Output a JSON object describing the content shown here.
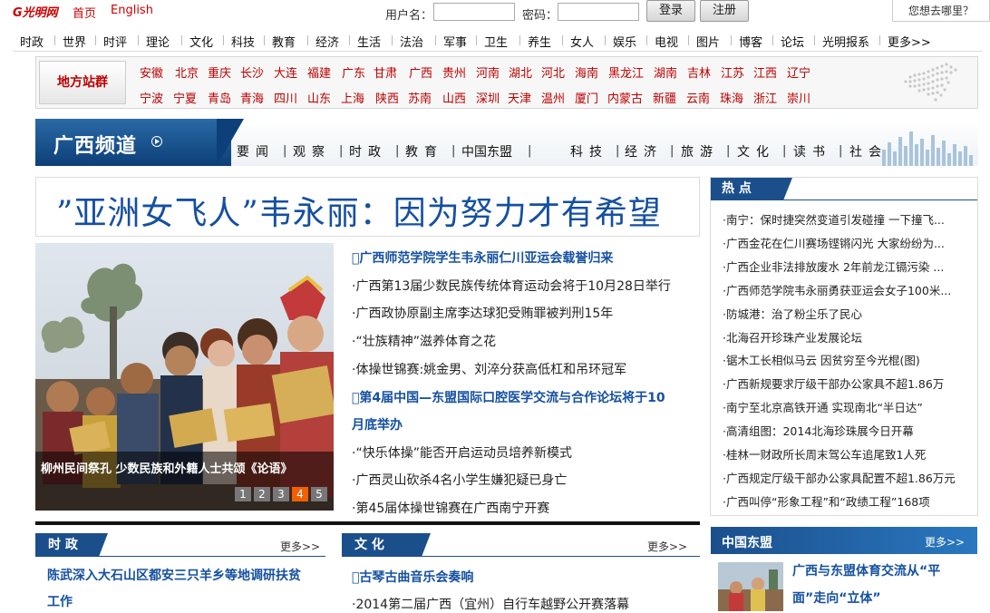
{
  "topbar": {
    "logo": "G光明网",
    "home": "首页",
    "english": "English",
    "username_label": "用户名：",
    "password_label": "密码：",
    "login": "登录",
    "register": "注册",
    "whereto": "您想去哪里？"
  },
  "mainnav": [
    "时政",
    "世界",
    "时评",
    "理论",
    "文化",
    "科技",
    "教育",
    "经济",
    "生活",
    "法治",
    "军事",
    "卫生",
    "养生",
    "女人",
    "娱乐",
    "电视",
    "图片",
    "博客",
    "论坛",
    "光明报系",
    "更多>>"
  ],
  "stations": {
    "label": "地方站群",
    "row1": [
      "安徽",
      "北京",
      "重庆",
      "长沙",
      "大连",
      "福建",
      "广东",
      "甘肃",
      "广西",
      "贵州",
      "河南",
      "湖北",
      "河北",
      "海南",
      "黑龙江",
      "湖南",
      "吉林",
      "江苏",
      "江西",
      "辽宁"
    ],
    "row2": [
      "宁波",
      "宁夏",
      "青岛",
      "青海",
      "四川",
      "山东",
      "上海",
      "陕西",
      "苏南",
      "山西",
      "深圳",
      "天津",
      "温州",
      "厦门",
      "内蒙古",
      "新疆",
      "云南",
      "珠海",
      "浙江",
      "崇川"
    ]
  },
  "channel": {
    "title": "广西频道",
    "nav": [
      "要闻",
      "观察",
      "时政",
      "教育",
      "中国东盟",
      "科技",
      "经济",
      "旅游",
      "文化",
      "读书",
      "社会"
    ]
  },
  "headline": "”亚洲女飞人”韦永丽：因为努力才有希望",
  "slideshow": {
    "caption": "柳州民间祭孔 少数民族和外籍人士共颂《论语》",
    "pages": [
      "1",
      "2",
      "3",
      "4",
      "5"
    ],
    "active_page": 4
  },
  "news": [
    {
      "text": "广西师范学院学生韦永丽仁川亚运会载誉归来",
      "bold": true
    },
    {
      "text": "·广西第13届少数民族传统体育运动会将于10月28日举行",
      "bold": false
    },
    {
      "text": "·广西政协原副主席李达球犯受贿罪被判刑15年",
      "bold": false
    },
    {
      "text": "·“壮族精神”滋养体育之花",
      "bold": false
    },
    {
      "text": "·体操世锦赛:姚金男、刘淬分获高低杠和吊环冠军",
      "bold": false
    },
    {
      "text": "第4届中国—东盟国际口腔医学交流与合作论坛将于10",
      "bold": true
    },
    {
      "text": "月底举办",
      "bold": true
    },
    {
      "text": "·“快乐体操”能否开启运动员培养新模式",
      "bold": false
    },
    {
      "text": "·广西灵山砍杀4名小学生嫌犯疑已身亡",
      "bold": false
    },
    {
      "text": "·第45届体操世锦赛在广西南宁开赛",
      "bold": false
    }
  ],
  "hot": {
    "title": "热 点",
    "items": [
      "·南宁：保时捷突然变道引发碰撞 一下撞飞...",
      "·广西金花在仁川赛场铿锵闪光 大家纷纷为...",
      "·广西企业非法排放废水 2年前龙江镉污染 ...",
      "·广西师范学院韦永丽勇获亚运会女子100米...",
      "·防城港：治了粉尘乐了民心",
      "·北海召开珍珠产业发展论坛",
      "·锯木工长相似马云 因贫穷至今光棍(图)",
      "·广西新规要求厅级干部办公家具不超1.86万",
      "·南宁至北京高铁开通 实现南北“半日达”",
      "·高清组图：2014北海珍珠展今日开幕",
      "·桂林一财政所长周末驾公车追尾致1人死",
      "·广西规定厅级干部办公家具配置不超1.86万元",
      "·广西叫停“形象工程”和“政绩工程”168项"
    ]
  },
  "sections": {
    "politics": {
      "title": "时 政",
      "more": "更多>>",
      "lead1": "陈武深入大石山区都安三只羊乡等地调研扶贫",
      "lead2": "工作"
    },
    "culture": {
      "title": "文 化",
      "more": "更多>>",
      "lead": "古琴古曲音乐会奏响",
      "item": "·2014第二届广西（宜州）自行车越野公开赛落幕"
    },
    "asean": {
      "title": "中国东盟",
      "more": "更多>>",
      "lead1": "广西与东盟体育交流从“平",
      "lead2": "面”走向“立体”"
    }
  },
  "colors": {
    "brand_red": "#cc0000",
    "link_blue": "#1550a0",
    "tab_blue": "#1b4f8c",
    "active_page": "#f06000"
  }
}
